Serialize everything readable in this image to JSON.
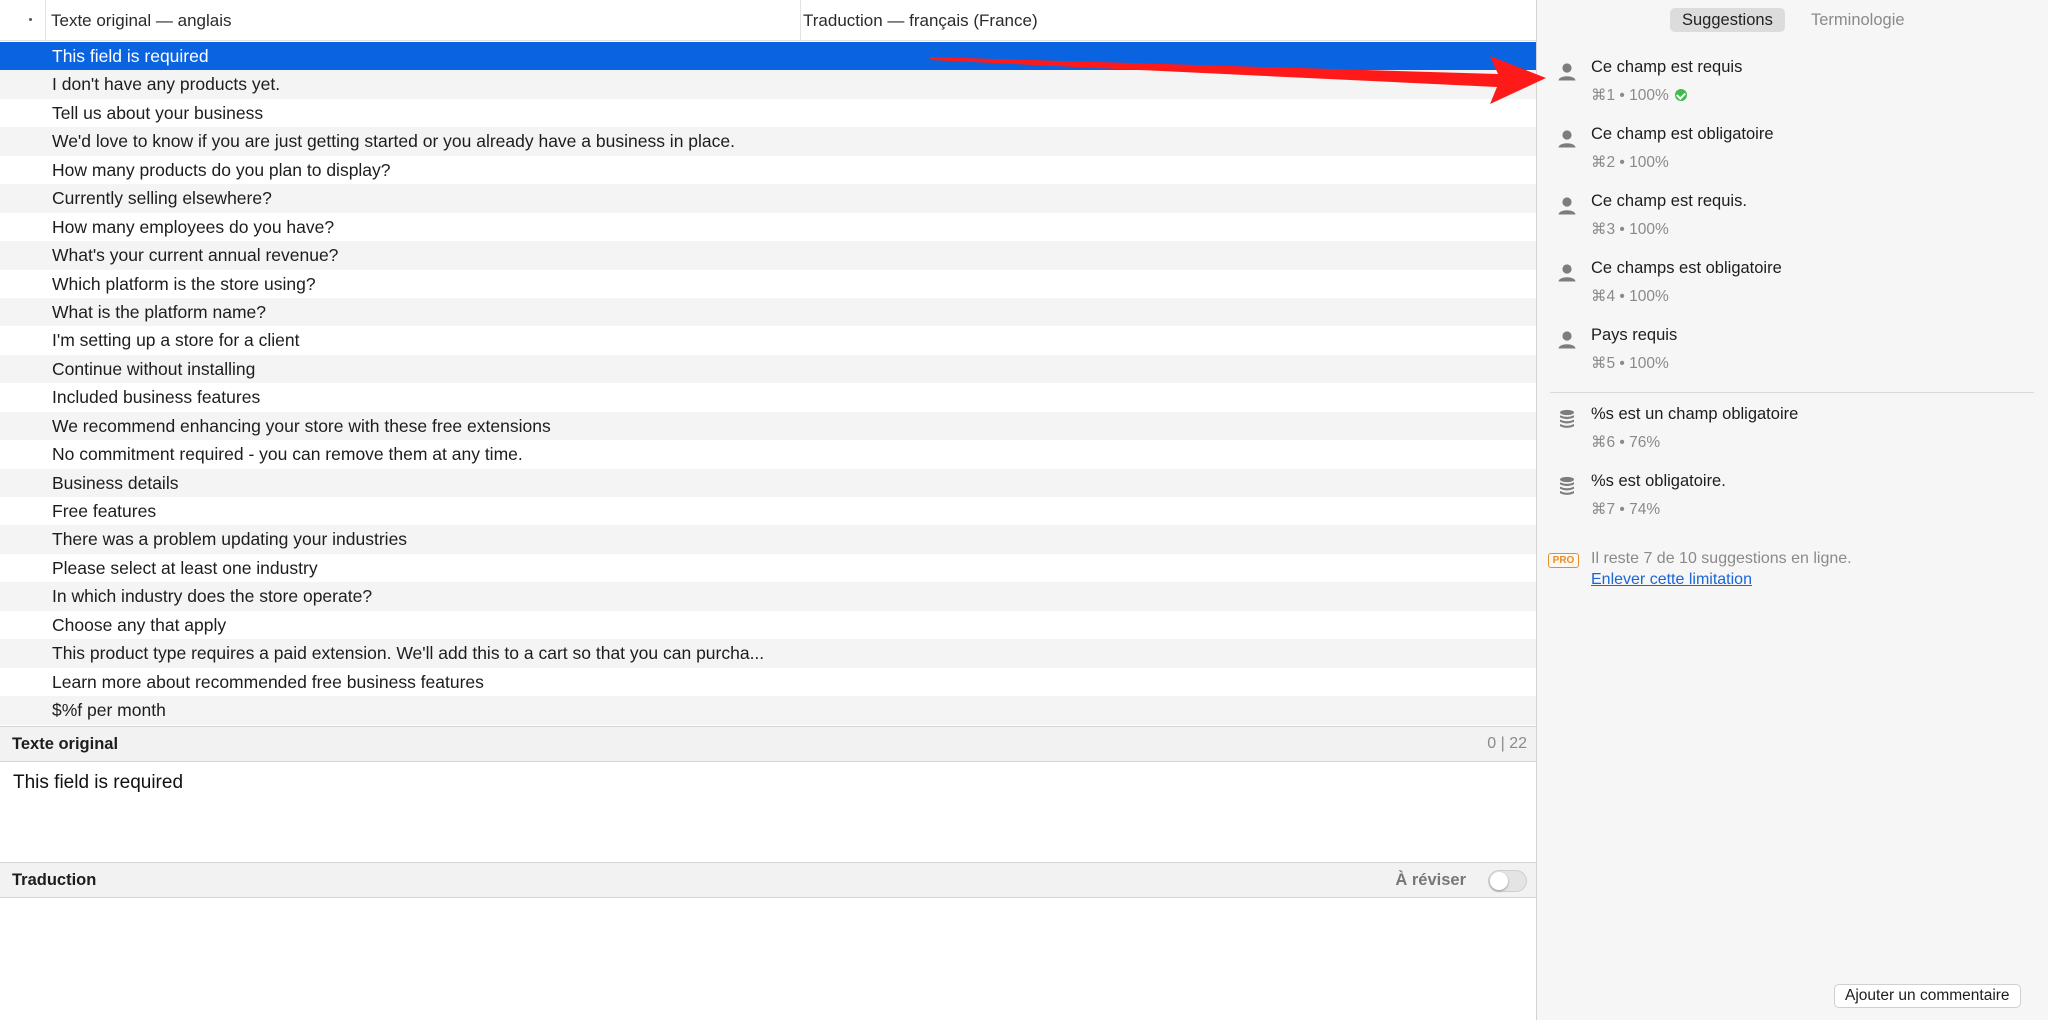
{
  "list_header": {
    "source_col": "Texte original — anglais",
    "target_col": "Traduction — français (France)"
  },
  "rows": [
    "This field is required",
    "I don't have any products yet.",
    "Tell us about your business",
    "We'd love to know if you are just getting started or you already have a business in place.",
    "How many products do you plan to display?",
    "Currently selling elsewhere?",
    "How many employees do you have?",
    "What's your current annual revenue?",
    "Which platform is the store using?",
    "What is the platform name?",
    "I'm setting up a store for a client",
    "Continue without installing",
    "Included business features",
    "We recommend enhancing your store with these free extensions",
    "No commitment required - you can remove them at any time.",
    "Business details",
    "Free features",
    "There was a problem updating your industries",
    "Please select at least one industry",
    "In which industry does the store operate?",
    "Choose any that apply",
    "This product type requires a paid extension. We'll add this to a cart so that you can purcha...",
    "Learn more about recommended free business features",
    "$%f per month"
  ],
  "source_panel": {
    "title": "Texte original",
    "count": "0 | 22",
    "text": "This field is required"
  },
  "translation_panel": {
    "title": "Traduction",
    "review_label": "À réviser"
  },
  "tabs": {
    "suggestions": "Suggestions",
    "terminology": "Terminologie"
  },
  "suggestions": [
    {
      "text": "Ce champ est requis",
      "meta": "⌘1 • 100%",
      "icon": "user-icon",
      "accepted": true
    },
    {
      "text": "Ce champ est obligatoire",
      "meta": "⌘2 • 100%",
      "icon": "user-icon"
    },
    {
      "text": "Ce champ est requis.",
      "meta": "⌘3 • 100%",
      "icon": "user-icon"
    },
    {
      "text": "Ce champs est obligatoire",
      "meta": "⌘4 • 100%",
      "icon": "user-icon"
    },
    {
      "text": "Pays requis",
      "meta": "⌘5 • 100%",
      "icon": "user-icon"
    },
    {
      "text": "%s est un champ obligatoire",
      "meta": "⌘6 • 76%",
      "icon": "database-icon"
    },
    {
      "text": "%s est obligatoire.",
      "meta": "⌘7 • 74%",
      "icon": "database-icon"
    }
  ],
  "pro": {
    "badge": "PRO",
    "limit_text": "Il reste 7 de 10 suggestions en ligne.",
    "link": "Enlever cette limitation"
  },
  "comment_button": "Ajouter un commentaire",
  "colors": {
    "selection": "#0a63e0",
    "arrow": "#ff1a1a",
    "link": "#1a66d9",
    "pro": "#e58e2d",
    "check": "#3fb950"
  }
}
